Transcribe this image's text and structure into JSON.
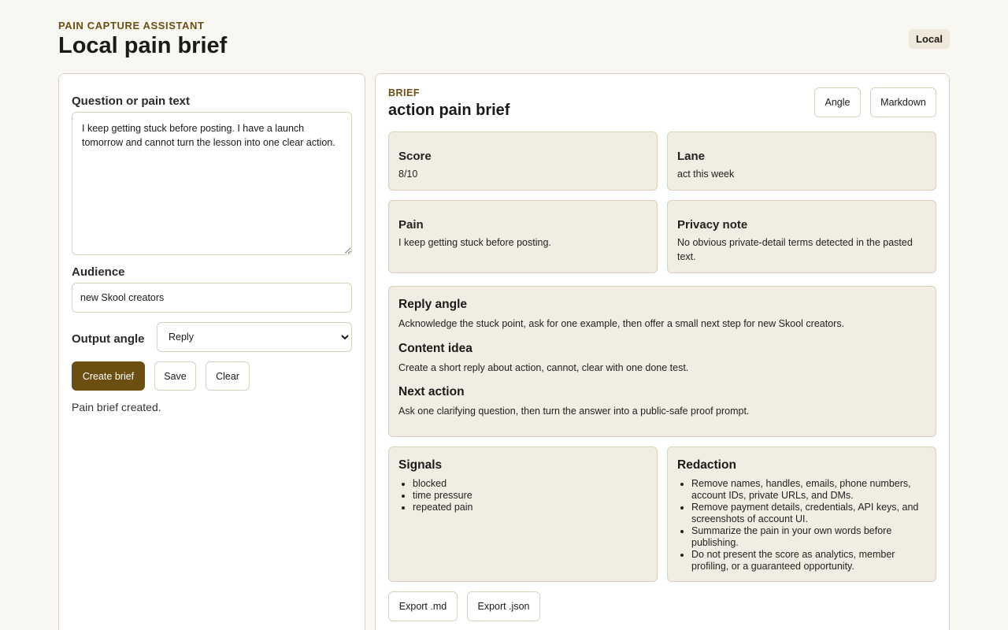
{
  "header": {
    "eyebrow": "PAIN CAPTURE ASSISTANT",
    "title": "Local pain brief",
    "badge": "Local"
  },
  "form": {
    "pain_label": "Question or pain text",
    "pain_value": "I keep getting stuck before posting. I have a launch tomorrow and cannot turn the lesson into one clear action.",
    "audience_label": "Audience",
    "audience_value": "new Skool creators",
    "angle_label": "Output angle",
    "angle_selected": "Reply",
    "create_label": "Create brief",
    "save_label": "Save",
    "clear_label": "Clear",
    "status": "Pain brief created."
  },
  "brief": {
    "eyebrow": "BRIEF",
    "title": "action pain brief",
    "angle_button": "Angle",
    "markdown_button": "Markdown",
    "score_label": "Score",
    "score_value": "8/10",
    "lane_label": "Lane",
    "lane_value": "act this week",
    "pain_label": "Pain",
    "pain_value": "I keep getting stuck before posting.",
    "privacy_label": "Privacy note",
    "privacy_value": "No obvious private-detail terms detected in the pasted text.",
    "reply_heading": "Reply angle",
    "reply_text": "Acknowledge the stuck point, ask for one example, then offer a small next step for new Skool creators.",
    "content_heading": "Content idea",
    "content_text": "Create a short reply about action, cannot, clear with one done test.",
    "next_heading": "Next action",
    "next_text": "Ask one clarifying question, then turn the answer into a public-safe proof prompt.",
    "signals_heading": "Signals",
    "signals": [
      "blocked",
      "time pressure",
      "repeated pain"
    ],
    "redaction_heading": "Redaction",
    "redaction": [
      "Remove names, handles, emails, phone numbers, account IDs, private URLs, and DMs.",
      "Remove payment details, credentials, API keys, and screenshots of account UI.",
      "Summarize the pain in your own words before publishing.",
      "Do not present the score as analytics, member profiling, or a guaranteed opportunity."
    ],
    "export_md": "Export .md",
    "export_json": "Export .json"
  },
  "colors": {
    "accent": "#6b4e10",
    "card_bg": "#f2ede2",
    "page_bg": "#f8f7f2"
  }
}
